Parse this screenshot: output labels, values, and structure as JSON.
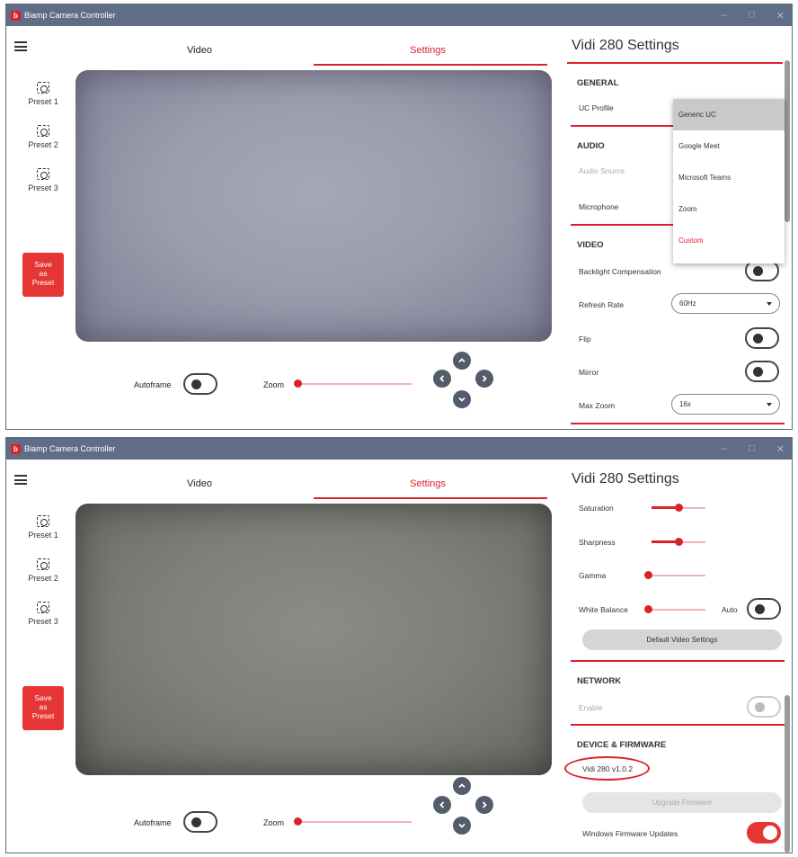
{
  "app": {
    "logo_letter": "b",
    "window_title": "Biamp Camera Controller"
  },
  "window_controls": [
    "–",
    "□",
    "✕"
  ],
  "tabs": {
    "video": "Video",
    "settings": "Settings"
  },
  "presets": [
    "Preset 1",
    "Preset 2",
    "Preset 3"
  ],
  "save_button": [
    "Save",
    "as",
    "Preset"
  ],
  "controls": {
    "autoframe": "Autoframe",
    "zoom": "Zoom",
    "autoframe_on": false,
    "zoom_level": 0
  },
  "settings_title": "Vidi 280 Settings",
  "top_panel": {
    "general_head": "GENERAL",
    "uc_profile_label": "UC Profile",
    "audio_head": "AUDIO",
    "audio_source_label": "Audio Source",
    "microphone_label": "Microphone",
    "video_head": "VIDEO",
    "backlight_label": "Backlight Compensation",
    "backlight_on": false,
    "refresh_rate_label": "Refresh Rate",
    "refresh_rate_value": "60Hz",
    "flip_label": "Flip",
    "flip_on": false,
    "mirror_label": "Mirror",
    "mirror_on": false,
    "max_zoom_label": "Max Zoom",
    "max_zoom_value": "16x",
    "uc_profile_options": [
      "Generic UC",
      "Google Meet",
      "Microsoft Teams",
      "Zoom",
      "Custom"
    ],
    "uc_profile_highlighted": "Generic UC"
  },
  "bottom_panel": {
    "saturation_label": "Saturation",
    "saturation_level": 0.5,
    "sharpness_label": "Sharpness",
    "sharpness_level": 0.5,
    "gamma_label": "Gamma",
    "gamma_level": 0,
    "white_balance_label": "White Balance",
    "white_balance_level": 0,
    "auto_label": "Auto",
    "white_balance_auto_on": false,
    "default_video_button": "Default Video Settings",
    "network_head": "NETWORK",
    "enable_label": "Enable",
    "network_enable_on": false,
    "device_head": "DEVICE & FIRMWARE",
    "firmware_version": "Vidi 280 v1.0.2",
    "upgrade_button": "Upgrade Firmware",
    "windows_updates_label": "Windows Firmware Updates",
    "windows_updates_on": true
  },
  "colors": {
    "accent": "#d9232a",
    "titlebar": "#5f6e86",
    "ptz": "#525c6a"
  }
}
